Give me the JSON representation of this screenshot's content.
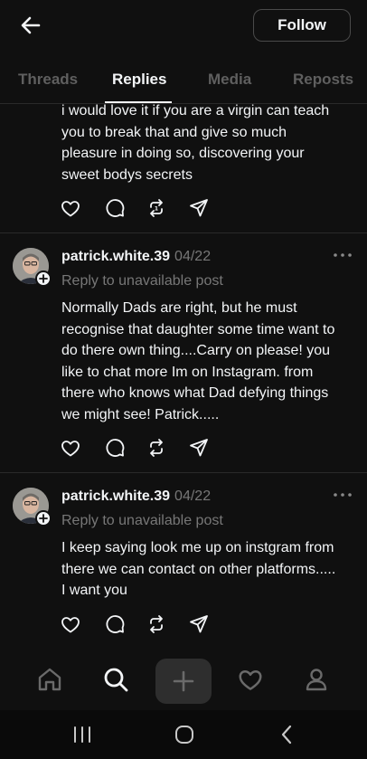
{
  "header": {
    "back_icon": "arrow-left-icon",
    "follow_label": "Follow"
  },
  "tabs": [
    {
      "label": "Threads",
      "active": false
    },
    {
      "label": "Replies",
      "active": true
    },
    {
      "label": "Media",
      "active": false
    },
    {
      "label": "Reposts",
      "active": false
    }
  ],
  "posts": [
    {
      "text_lines": [
        "i would love it if you are a virgin can teach",
        "you to break that and give so much",
        "pleasure in doing so, discovering your",
        "sweet bodys secrets"
      ]
    },
    {
      "username": "patrick.white.39",
      "date": "04/22",
      "reply_to": "Reply to unavailable post",
      "text_lines": [
        "Normally Dads are right, but he must",
        "recognise that daughter some time want to",
        "do there own thing....Carry on please! you",
        "like to chat more Im on Instagram. from",
        "there who knows what Dad defying things",
        "we might see! Patrick....."
      ]
    },
    {
      "username": "patrick.white.39",
      "date": "04/22",
      "reply_to": "Reply to unavailable post",
      "text_lines": [
        "I keep saying look me up on instgram from",
        "there we can contact on other platforms.....",
        "I want you"
      ]
    }
  ],
  "action_icons": [
    "heart-icon",
    "comment-icon",
    "repost-icon",
    "share-icon"
  ],
  "bottom_nav": [
    "home-icon",
    "search-icon",
    "plus-icon",
    "heart-icon",
    "profile-icon"
  ],
  "system_nav": [
    "recents-icon",
    "home-circle-icon",
    "back-chevron-icon"
  ],
  "colors": {
    "background": "#101010",
    "text": "#f3f5f7",
    "muted": "#777777",
    "inactive_tab": "#5f5f5f",
    "divider": "#2a2a2a"
  }
}
